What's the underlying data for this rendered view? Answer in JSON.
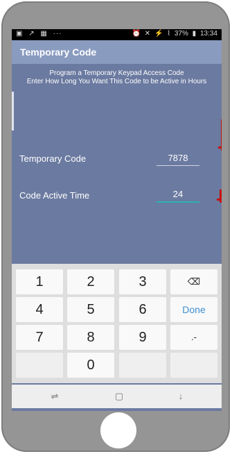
{
  "status_bar": {
    "left_icons": [
      "image-icon",
      "missed-call-icon",
      "gallery-icon",
      "more-icon"
    ],
    "left_glyphs": [
      "▣",
      "↗",
      "▦",
      "···"
    ],
    "right_glyphs": [
      "⏰",
      "✕",
      "⚡",
      "⌇"
    ],
    "battery": "37%",
    "time": "13:34"
  },
  "app_bar": {
    "title": "Temporary Code"
  },
  "description": {
    "line1": "Program a Temporary Keypad Access Code",
    "line2": "Enter How Long You Want This Code to be Active in Hours"
  },
  "fields": {
    "temporary_code": {
      "label": "Temporary Code",
      "value": "7878"
    },
    "code_active_time": {
      "label": "Code Active Time",
      "value": "24"
    }
  },
  "keyboard": {
    "keys": [
      "1",
      "2",
      "3",
      "⌫",
      "4",
      "5",
      "6",
      "Done",
      "7",
      "8",
      "9",
      ".-",
      "",
      "0",
      "",
      ""
    ]
  },
  "nav_bar": {
    "recent": "⇌",
    "home": "▢",
    "back": "↓"
  },
  "colors": {
    "screen": "#6b7aa0",
    "app_bar": "#8a9bc0",
    "accent": "#2ab4b0",
    "annotation": "#c41010"
  }
}
